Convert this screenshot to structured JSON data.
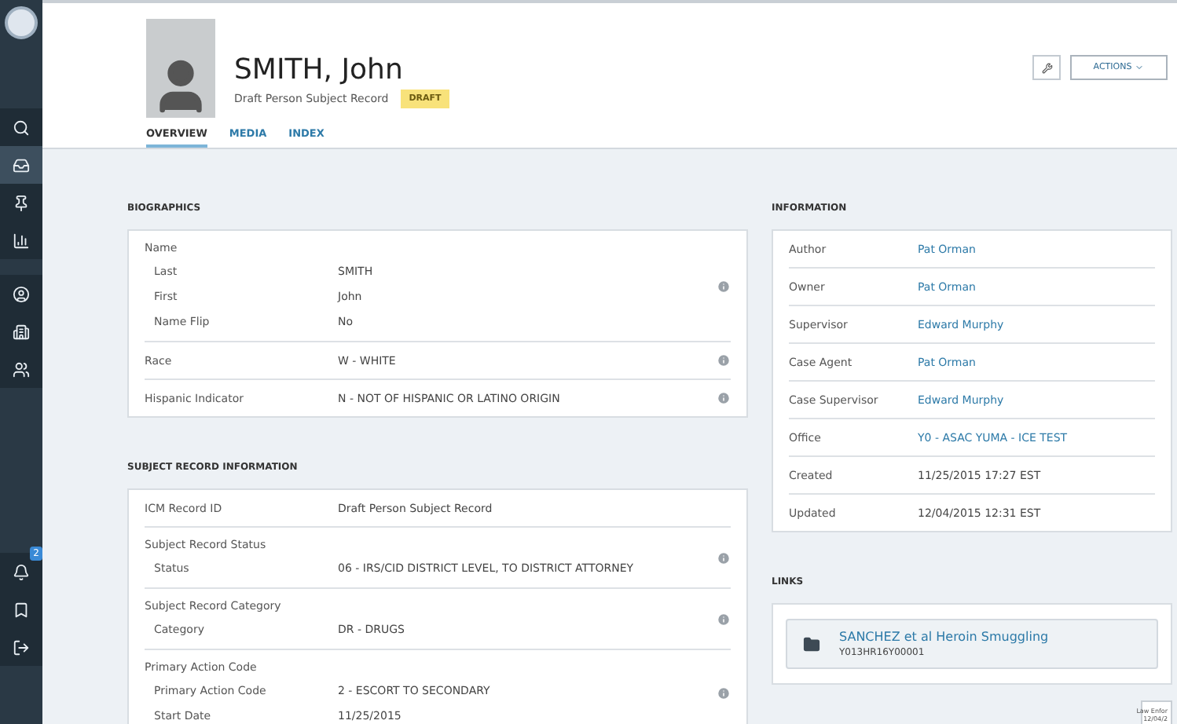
{
  "sidebar": {
    "items": [
      {
        "kind": "search",
        "selected": false
      },
      {
        "kind": "tray",
        "selected": true
      },
      {
        "kind": "pin",
        "selected": false
      },
      {
        "kind": "chart",
        "selected": false
      },
      {
        "kind": "person",
        "selected": false
      },
      {
        "kind": "building",
        "selected": false
      },
      {
        "kind": "people",
        "selected": false
      },
      {
        "kind": "bell",
        "selected": false,
        "badge": "2"
      },
      {
        "kind": "bookmark",
        "selected": false
      },
      {
        "kind": "logout",
        "selected": false
      }
    ]
  },
  "header": {
    "name": "SMITH, John",
    "subtitle": "Draft Person Subject Record",
    "status": "DRAFT",
    "actions": "ACTIONS"
  },
  "tabs": [
    {
      "label": "OVERVIEW",
      "selected": true
    },
    {
      "label": "MEDIA",
      "selected": false
    },
    {
      "label": "INDEX",
      "selected": false
    }
  ],
  "biographics": {
    "title": "BIOGRAPHICS",
    "items": [
      {
        "kind": "group",
        "label": "Name",
        "info": true,
        "rows": [
          {
            "label": "Last",
            "value": "SMITH"
          },
          {
            "label": "First",
            "value": "John"
          },
          {
            "label": "Name Flip",
            "value": "No"
          }
        ]
      },
      {
        "kind": "field",
        "label": "Race",
        "value": "W - WHITE",
        "info": true
      },
      {
        "kind": "field",
        "label": "Hispanic Indicator",
        "value": "N - NOT OF HISPANIC OR LATINO ORIGIN",
        "info": true
      }
    ]
  },
  "subject_record": {
    "title": "SUBJECT RECORD INFORMATION",
    "items": [
      {
        "kind": "field",
        "label": "ICM Record ID",
        "value": "Draft Person Subject Record",
        "info": false
      },
      {
        "kind": "group",
        "label": "Subject Record Status",
        "info": true,
        "rows": [
          {
            "label": "Status",
            "value": "06 - IRS/CID DISTRICT LEVEL, TO DISTRICT ATTORNEY"
          }
        ]
      },
      {
        "kind": "group",
        "label": "Subject Record Category",
        "info": true,
        "rows": [
          {
            "label": "Category",
            "value": "DR - DRUGS"
          }
        ]
      },
      {
        "kind": "group",
        "label": "Primary Action Code",
        "info": true,
        "rows": [
          {
            "label": "Primary Action Code",
            "value": "2 - ESCORT TO SECONDARY"
          },
          {
            "label": "Start Date",
            "value": "11/25/2015"
          }
        ]
      }
    ]
  },
  "information": {
    "title": "INFORMATION",
    "rows": [
      {
        "label": "Author",
        "value": "Pat Orman",
        "link": true
      },
      {
        "label": "Owner",
        "value": "Pat Orman",
        "link": true
      },
      {
        "label": "Supervisor",
        "value": "Edward Murphy",
        "link": true
      },
      {
        "label": "Case Agent",
        "value": "Pat Orman",
        "link": true
      },
      {
        "label": "Case Supervisor",
        "value": "Edward Murphy",
        "link": true
      },
      {
        "label": "Office",
        "value": "Y0 - ASAC YUMA - ICE TEST",
        "link": true
      },
      {
        "label": "Created",
        "value": "11/25/2015 17:27 EST",
        "link": false
      },
      {
        "label": "Updated",
        "value": "12/04/2015 12:31 EST",
        "link": false
      }
    ]
  },
  "links": {
    "title": "LINKS",
    "items": [
      {
        "title": "SANCHEZ et al Heroin Smuggling",
        "id": "Y013HR16Y00001"
      }
    ]
  },
  "tooltip": {
    "lines": [
      "Law Enfor",
      "12/04/2"
    ]
  }
}
